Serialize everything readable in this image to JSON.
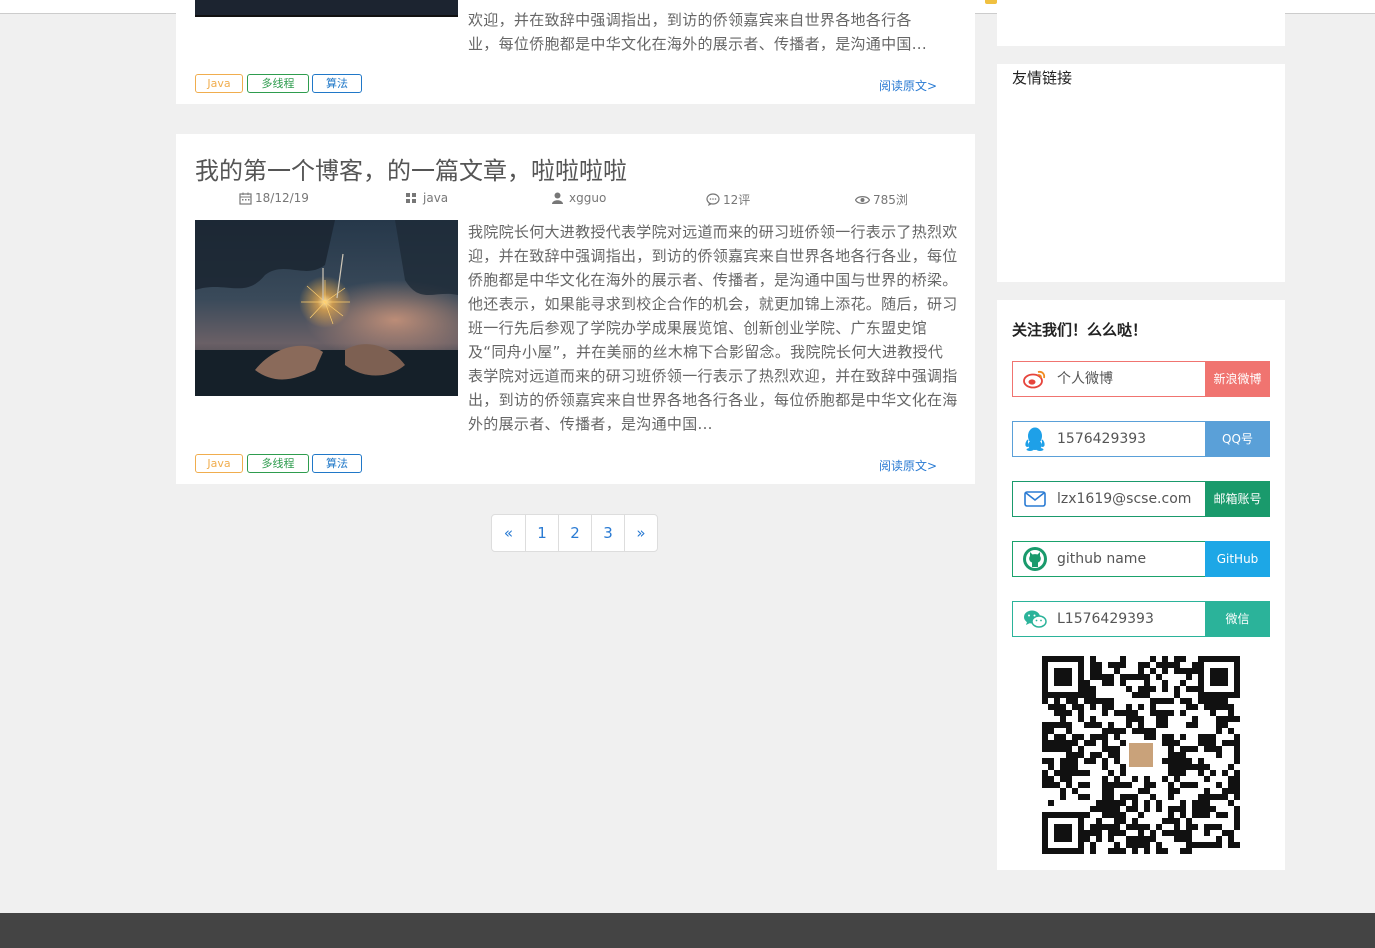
{
  "post_top": {
    "excerpt_lines": [
      "欢迎，并在致辞中强调指出，到访的侨领嘉宾来自世界各地各行各",
      "业，每位侨胞都是中华文化在海外的展示者、传播者，是沟通中国..."
    ],
    "tags": [
      "Java",
      "多线程",
      "算法"
    ],
    "read_more": "阅读原文>"
  },
  "post_main": {
    "title": "我的第一个博客，的一篇文章，啦啦啦啦",
    "date": "18/12/19",
    "category": "java",
    "author": "xgguo",
    "comments": "12评",
    "views": "785浏",
    "excerpt": "我院院长何大进教授代表学院对远道而来的研习班侨领一行表示了热烈欢迎，并在致辞中强调指出，到访的侨领嘉宾来自世界各地各行各业，每位侨胞都是中华文化在海外的展示者、传播者，是沟通中国与世界的桥梁。他还表示，如果能寻求到校企合作的机会，就更加锦上添花。随后，研习班一行先后参观了学院办学成果展览馆、创新创业学院、广东盟史馆及“同舟小屋”，并在美丽的丝木棉下合影留念。我院院长何大进教授代表学院对远道而来的研习班侨领一行表示了热烈欢迎，并在致辞中强调指出，到访的侨领嘉宾来自世界各地各行各业，每位侨胞都是中华文化在海外的展示者、传播者，是沟通中国...",
    "tags": [
      "Java",
      "多线程",
      "算法"
    ],
    "read_more": "阅读原文>"
  },
  "pagination": {
    "prev": "«",
    "pages": [
      "1",
      "2",
      "3"
    ],
    "next": "»"
  },
  "sidebar": {
    "links_title": "友情链接",
    "follow_title": "关注我们！么么哒！",
    "follow": [
      {
        "icon": "weibo-icon",
        "value": "个人微博",
        "button": "新浪微博",
        "color": "#f07470"
      },
      {
        "icon": "qq-icon",
        "value": "1576429393",
        "button": "QQ号",
        "color": "#5aa0d8"
      },
      {
        "icon": "mail-icon",
        "value": "lzx1619@scse.com",
        "button": "邮箱账号",
        "color": "#1a9a6c"
      },
      {
        "icon": "github-icon",
        "value": "github name",
        "button": "GitHub",
        "color": "#1da7e6"
      },
      {
        "icon": "wechat-icon",
        "value": "L1576429393",
        "button": "微信",
        "color": "#2bb39a"
      }
    ]
  }
}
